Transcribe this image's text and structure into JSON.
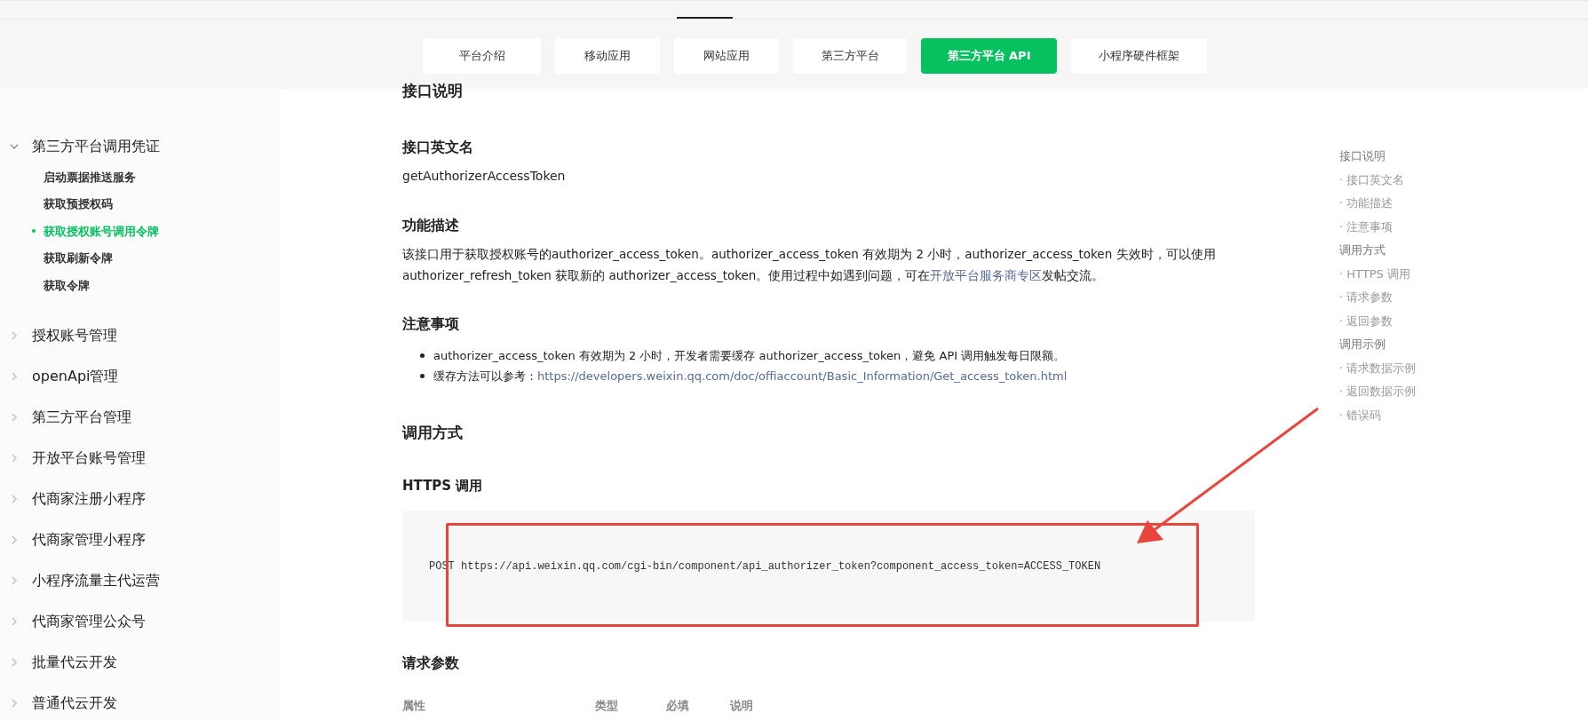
{
  "nav_tabs": [
    {
      "label": "平台介绍",
      "selected": false
    },
    {
      "label": "移动应用",
      "selected": false
    },
    {
      "label": "网站应用",
      "selected": false
    },
    {
      "label": "第三方平台",
      "selected": false
    },
    {
      "label": "第三方平台 API",
      "selected": true
    },
    {
      "label": "小程序硬件框架",
      "selected": false
    }
  ],
  "sidebar": {
    "items": [
      {
        "label": "第三方平台调用凭证",
        "expanded": true,
        "children": [
          {
            "label": "启动票据推送服务",
            "selected": false
          },
          {
            "label": "获取预授权码",
            "selected": false
          },
          {
            "label": "获取授权账号调用令牌",
            "selected": true
          },
          {
            "label": "获取刷新令牌",
            "selected": false
          },
          {
            "label": "获取令牌",
            "selected": false
          }
        ]
      },
      {
        "label": "授权账号管理",
        "expanded": false
      },
      {
        "label": "openApi管理",
        "expanded": false
      },
      {
        "label": "第三方平台管理",
        "expanded": false
      },
      {
        "label": "开放平台账号管理",
        "expanded": false
      },
      {
        "label": "代商家注册小程序",
        "expanded": false
      },
      {
        "label": "代商家管理小程序",
        "expanded": false
      },
      {
        "label": "小程序流量主代运营",
        "expanded": false
      },
      {
        "label": "代商家管理公众号",
        "expanded": false
      },
      {
        "label": "批量代云开发",
        "expanded": false
      },
      {
        "label": "普通代云开发",
        "expanded": false
      }
    ]
  },
  "content": {
    "section_title": "接口说明",
    "english_name": {
      "heading": "接口英文名",
      "value": "getAuthorizerAccessToken"
    },
    "description": {
      "heading": "功能描述",
      "text_before": "该接口用于获取授权账号的authorizer_access_token。authorizer_access_token 有效期为 2 小时，authorizer_access_token 失效时，可以使用 authorizer_refresh_token 获取新的 authorizer_access_token。使用过程中如遇到问题，可在",
      "link": "开放平台服务商专区",
      "text_after": "发帖交流。"
    },
    "notes": {
      "heading": "注意事项",
      "items": [
        {
          "text": "authorizer_access_token 有效期为 2 小时，开发者需要缓存 authorizer_access_token，避免 API 调用触发每日限额。"
        },
        {
          "text": "缓存方法可以参考：",
          "link": "https://developers.weixin.qq.com/doc/offiaccount/Basic_Information/Get_access_token.html"
        }
      ]
    },
    "call_method": {
      "title": "调用方式",
      "https_heading": "HTTPS 调用",
      "code": "POST https://api.weixin.qq.com/cgi-bin/component/api_authorizer_token?component_access_token=ACCESS_TOKEN"
    },
    "request_params": {
      "heading": "请求参数",
      "columns": [
        "属性",
        "类型",
        "必填",
        "说明"
      ]
    }
  },
  "toc": [
    {
      "label": "接口说明",
      "kind": "section"
    },
    {
      "label": "· 接口英文名",
      "kind": "sub"
    },
    {
      "label": "· 功能描述",
      "kind": "sub"
    },
    {
      "label": "· 注意事项",
      "kind": "sub"
    },
    {
      "label": "调用方式",
      "kind": "section"
    },
    {
      "label": "· HTTPS 调用",
      "kind": "sub"
    },
    {
      "label": "· 请求参数",
      "kind": "sub"
    },
    {
      "label": "· 返回参数",
      "kind": "sub"
    },
    {
      "label": "调用示例",
      "kind": "section"
    },
    {
      "label": "· 请求数据示例",
      "kind": "sub"
    },
    {
      "label": "· 返回数据示例",
      "kind": "sub"
    },
    {
      "label": "· 错误码",
      "kind": "sub"
    }
  ]
}
